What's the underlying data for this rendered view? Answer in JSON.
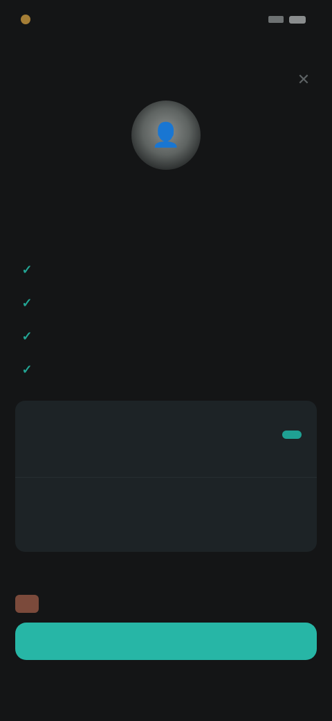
{
  "status_bar": {
    "time": "",
    "battery": ""
  },
  "header": {
    "close_icon": "close-icon"
  },
  "hero": {
    "avatar_icon": "avatar-icon",
    "title": "",
    "subtitle": ""
  },
  "features": [
    {
      "icon": "check-icon",
      "label": ""
    },
    {
      "icon": "check-icon",
      "label": ""
    },
    {
      "icon": "check-icon",
      "label": ""
    },
    {
      "icon": "check-icon",
      "label": ""
    }
  ],
  "plans": [
    {
      "name": "",
      "description": "",
      "badge": "",
      "price": ""
    },
    {
      "name": "",
      "description": "",
      "price": ""
    }
  ],
  "section_note": "",
  "promo_icon": "gift-icon",
  "cta": {
    "label": ""
  },
  "footer": {
    "text": ""
  },
  "colors": {
    "accent": "#27b6a6",
    "background": "#141516",
    "card": "#1d2326"
  }
}
